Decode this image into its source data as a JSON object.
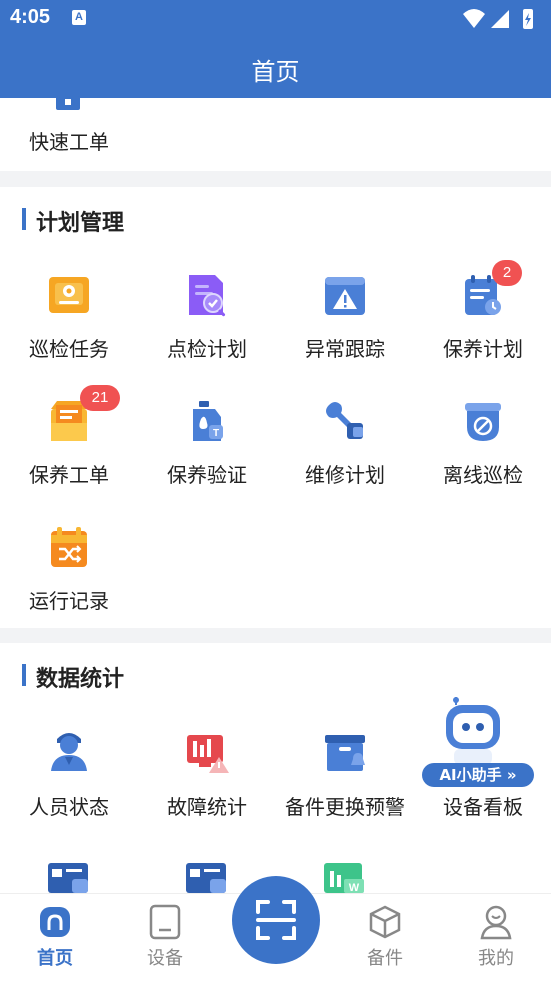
{
  "status": {
    "time": "4:05",
    "a_icon": "A"
  },
  "appbar": {
    "title": "首页"
  },
  "top": {
    "item_label": "快速工单"
  },
  "plan": {
    "title": "计划管理",
    "items": [
      {
        "label": "巡检任务",
        "icon": "inspection-task-icon"
      },
      {
        "label": "点检计划",
        "icon": "spot-check-plan-icon"
      },
      {
        "label": "异常跟踪",
        "icon": "anomaly-tracking-icon"
      },
      {
        "label": "保养计划",
        "icon": "maintenance-plan-icon",
        "badge": "2"
      },
      {
        "label": "保养工单",
        "icon": "maintenance-order-icon",
        "badge": "21"
      },
      {
        "label": "保养验证",
        "icon": "maintenance-verify-icon"
      },
      {
        "label": "维修计划",
        "icon": "repair-plan-icon"
      },
      {
        "label": "离线巡检",
        "icon": "offline-inspection-icon"
      },
      {
        "label": "运行记录",
        "icon": "run-record-icon"
      }
    ]
  },
  "stats": {
    "title": "数据统计",
    "items": [
      {
        "label": "人员状态",
        "icon": "staff-status-icon"
      },
      {
        "label": "故障统计",
        "icon": "fault-stats-icon"
      },
      {
        "label": "备件更换预警",
        "icon": "spare-warning-icon"
      },
      {
        "label": "设备看板",
        "icon": "equipment-board-icon"
      }
    ]
  },
  "assistant": {
    "label": "AI小助手 »"
  },
  "tabs": [
    {
      "label": "首页",
      "icon": "home-icon",
      "active": true
    },
    {
      "label": "设备",
      "icon": "device-icon"
    },
    {
      "label": "备件",
      "icon": "spare-parts-icon"
    },
    {
      "label": "我的",
      "icon": "profile-icon"
    }
  ],
  "colors": {
    "primary": "#3b73c8",
    "badge": "#f05252"
  }
}
